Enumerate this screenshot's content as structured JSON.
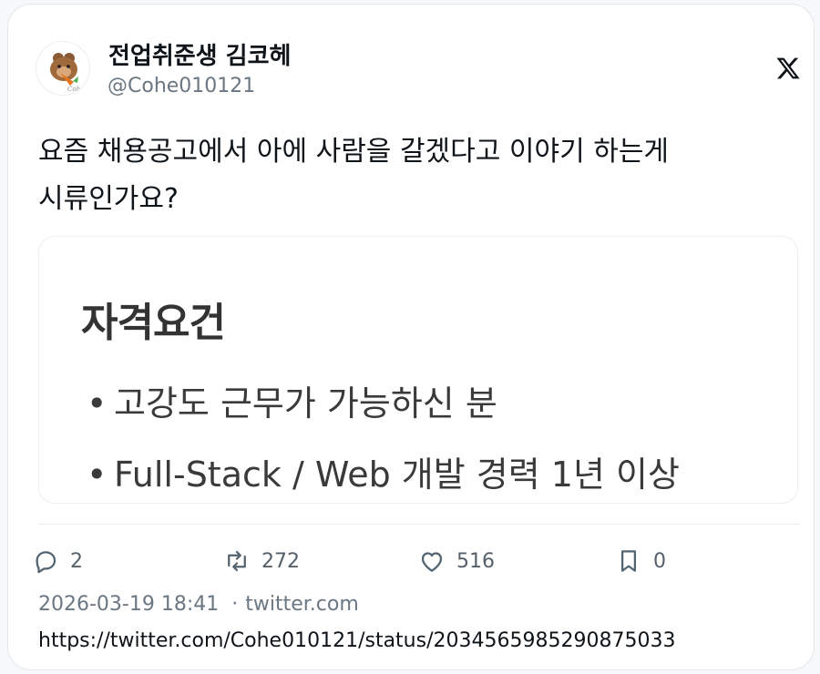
{
  "author": {
    "display_name": "전업취준생 김코헤",
    "handle": "@Cohe010121",
    "avatar_caption": "Cohe"
  },
  "platform_icon": "x-logo-icon",
  "tweet": {
    "lines": [
      "요즘 채용공고에서 아에 사람을 갈겠다고 이야기 하는게",
      "시류인가요?"
    ]
  },
  "media": {
    "heading": "자격요건",
    "bullets": [
      "고강도 근무가 가능하신 분",
      "Full-Stack / Web 개발 경력 1년 이상"
    ],
    "bullet_glyph": "•"
  },
  "actions": {
    "reply": {
      "icon": "reply-icon",
      "count": "2"
    },
    "retweet": {
      "icon": "retweet-icon",
      "count": "272"
    },
    "like": {
      "icon": "heart-icon",
      "count": "516"
    },
    "bookmark": {
      "icon": "bookmark-icon",
      "count": "0"
    }
  },
  "meta": {
    "timestamp": "2026-03-19 18:41",
    "separator": "·",
    "source": "twitter.com"
  },
  "url": "https://twitter.com/Cohe010121/status/2034565985290875033",
  "colors": {
    "text": "#0f1419",
    "secondary": "#6b7782",
    "border": "#e4e7ea",
    "avatar_accent": "#e8761e"
  }
}
